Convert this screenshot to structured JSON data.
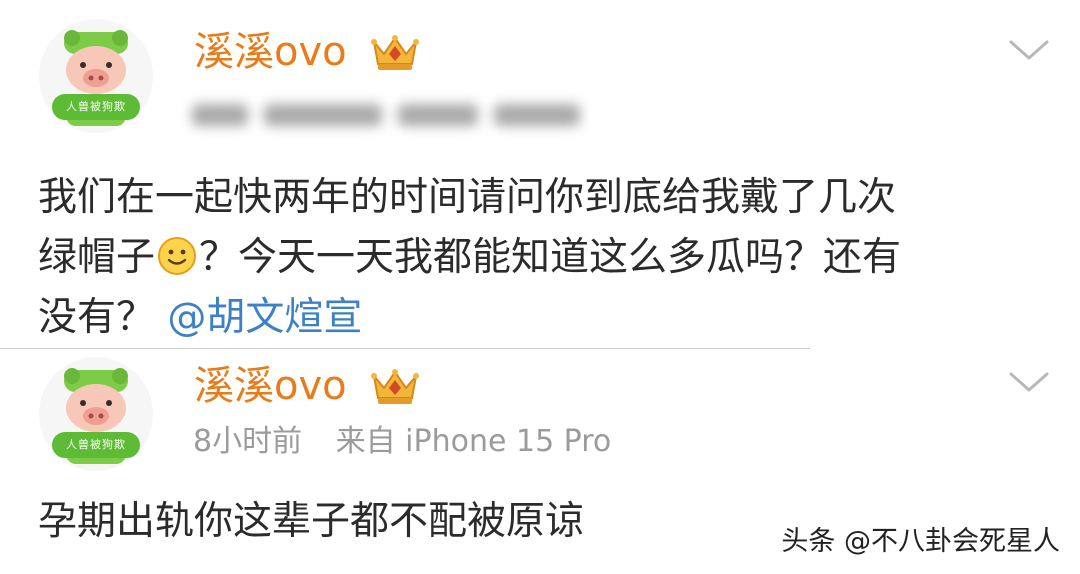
{
  "posts": [
    {
      "username": "溪溪ovo",
      "avatar_badge": "人兽被狗欺",
      "content_lines": [
        "我们在一起快两年的时间请问你到底给我戴了几次",
        "绿帽子",
        "？今天一天我都能知道这么多瓜吗？还有",
        "没有？"
      ],
      "mention": "@胡文煊宣"
    },
    {
      "username": "溪溪ovo",
      "avatar_badge": "人兽被狗欺",
      "time": "8小时前",
      "source": "来自 iPhone 15 Pro",
      "content": "孕期出轨你这辈子都不配被原谅"
    }
  ],
  "icons": {
    "vip": "crown-vip-icon",
    "menu": "chevron-down-icon",
    "emoji": "smile-emoji-icon"
  },
  "colors": {
    "username": "#ea7b19",
    "mention": "#3d80c8",
    "meta": "#9b9b9b",
    "avatar_badge": "#5dbb35"
  },
  "watermark": "头条 @不八卦会死星人"
}
